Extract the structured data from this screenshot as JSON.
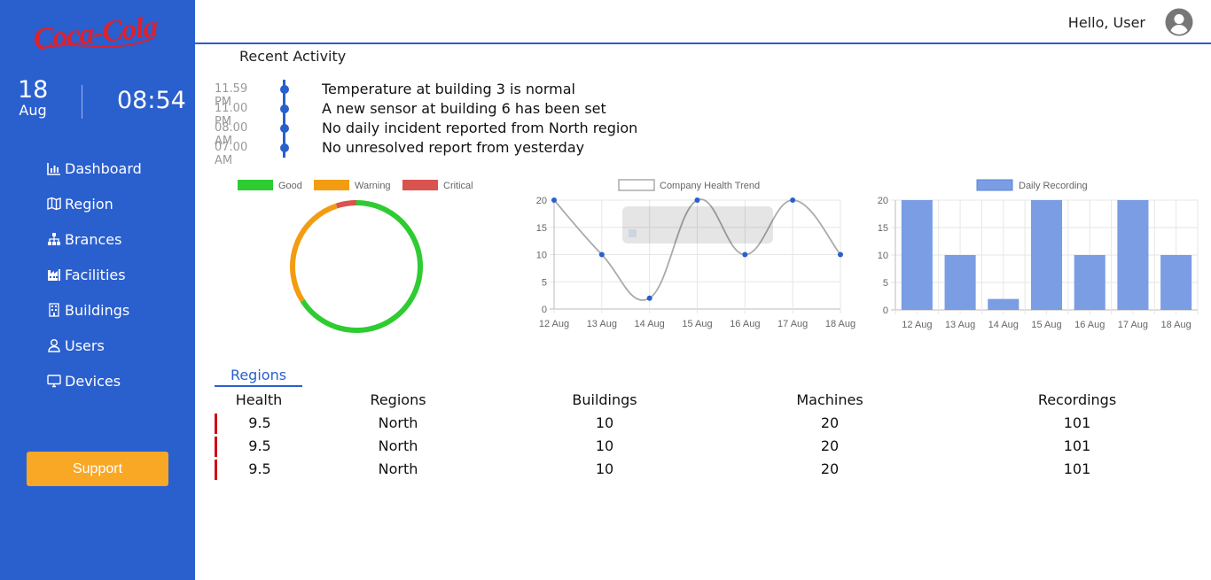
{
  "brand": {
    "logo_text": "Coca-Cola"
  },
  "sidebar": {
    "date_day": "18",
    "date_month": "Aug",
    "clock": "08:54",
    "items": [
      {
        "label": "Dashboard",
        "icon": "bar-chart-icon"
      },
      {
        "label": "Region",
        "icon": "map-icon"
      },
      {
        "label": "Brances",
        "icon": "sitemap-icon"
      },
      {
        "label": "Facilities",
        "icon": "industry-icon"
      },
      {
        "label": "Buildings",
        "icon": "building-icon"
      },
      {
        "label": "Users",
        "icon": "user-icon"
      },
      {
        "label": "Devices",
        "icon": "desktop-icon"
      }
    ],
    "support_label": "Support"
  },
  "header": {
    "greeting": "Hello, User",
    "avatar_icon": "user-circle-icon"
  },
  "recent_activity": {
    "title": "Recent Activity",
    "items": [
      {
        "time": "11.59 PM",
        "message": "Temperature at building 3 is normal"
      },
      {
        "time": "11.00 PM",
        "message": "A new sensor at building 6 has been set"
      },
      {
        "time": "08.00 AM",
        "message": "No daily incident reported from North region"
      },
      {
        "time": "07.00 AM",
        "message": "No unresolved report from yesterday"
      }
    ]
  },
  "colors": {
    "primary": "#2a5fce",
    "good": "#2ecc31",
    "warning": "#f39c12",
    "critical": "#d9534f",
    "support": "#f9a825",
    "row_flag": "#d0021b"
  },
  "chart_data": [
    {
      "type": "pie",
      "style": "doughnut",
      "legend": [
        "Good",
        "Warning",
        "Critical"
      ],
      "values": [
        66,
        29,
        5
      ],
      "colors": [
        "#2ecc31",
        "#f39c12",
        "#d9534f"
      ]
    },
    {
      "type": "line",
      "title": "Company Health Trend",
      "categories": [
        "12 Aug",
        "13 Aug",
        "14 Aug",
        "15 Aug",
        "16 Aug",
        "17 Aug",
        "18 Aug"
      ],
      "values": [
        20,
        10,
        2,
        20,
        10,
        20,
        10
      ],
      "ylim": [
        0,
        20
      ],
      "yticks": [
        0,
        5,
        10,
        15,
        20
      ],
      "grid": true
    },
    {
      "type": "bar",
      "title": "Daily Recording",
      "categories": [
        "12 Aug",
        "13 Aug",
        "14 Aug",
        "15 Aug",
        "16 Aug",
        "17 Aug",
        "18 Aug"
      ],
      "values": [
        20,
        10,
        2,
        20,
        10,
        20,
        10
      ],
      "ylim": [
        0,
        20
      ],
      "yticks": [
        0,
        5,
        10,
        15,
        20
      ],
      "grid": true
    }
  ],
  "regions_table": {
    "tab_label": "Regions",
    "columns": [
      "Health",
      "Regions",
      "Buildings",
      "Machines",
      "Recordings"
    ],
    "rows": [
      [
        "9.5",
        "North",
        "10",
        "20",
        "101"
      ],
      [
        "9.5",
        "North",
        "10",
        "20",
        "101"
      ],
      [
        "9.5",
        "North",
        "10",
        "20",
        "101"
      ]
    ]
  }
}
